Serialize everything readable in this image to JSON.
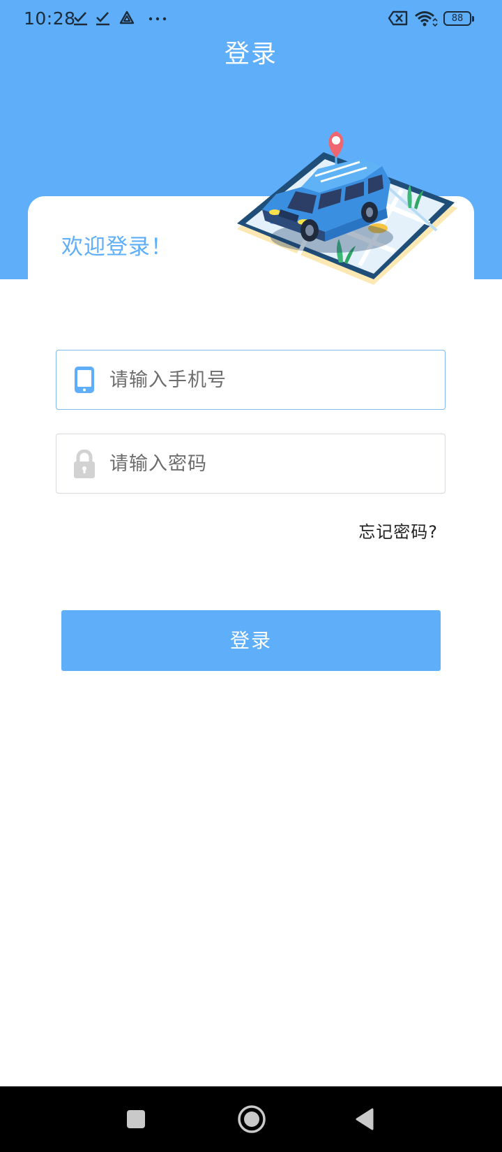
{
  "status_bar": {
    "time": "10:28",
    "battery": "88",
    "icons": [
      "check-icon",
      "check-icon",
      "drive-icon",
      "more-dots-icon",
      "sim-off-icon",
      "wifi-icon",
      "battery-icon"
    ]
  },
  "header": {
    "title": "登录",
    "background_color": "#5eaefa"
  },
  "card": {
    "welcome": "欢迎登录！",
    "illustration": "car-on-map-illustration"
  },
  "form": {
    "phone": {
      "placeholder": "请输入手机号",
      "value": "",
      "icon": "phone-icon"
    },
    "password": {
      "placeholder": "请输入密码",
      "value": "",
      "icon": "lock-icon"
    },
    "forgot_label": "忘记密码?",
    "submit_label": "登录"
  },
  "nav_bar": {
    "buttons": [
      "recents-square-icon",
      "home-circle-icon",
      "back-triangle-icon"
    ]
  },
  "colors": {
    "accent": "#5eaefa",
    "field_border_active": "#7fb8ec",
    "field_border": "#d6d9dd",
    "lock_icon": "#d2d2d2"
  }
}
